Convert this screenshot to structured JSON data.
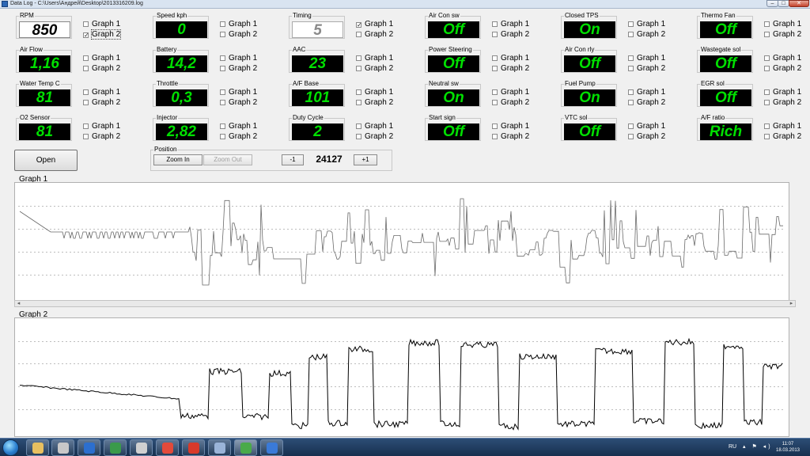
{
  "window": {
    "title": "Data Log - C:\\Users\\Андрей\\Desktop\\2013316209.log",
    "minimize_glyph": "–",
    "maximize_glyph": "□",
    "close_glyph": "✕"
  },
  "checkbox_labels": {
    "graph1": "Graph 1",
    "graph2": "Graph 2"
  },
  "sensors": [
    {
      "label": "RPM",
      "value": "850",
      "style": "white",
      "graph1": false,
      "graph2": true
    },
    {
      "label": "Speed kph",
      "value": "0",
      "style": "green",
      "graph1": false,
      "graph2": false
    },
    {
      "label": "Timing",
      "value": "5",
      "style": "dim",
      "graph1": true,
      "graph2": false
    },
    {
      "label": "Air Con sw",
      "value": "Off",
      "style": "green",
      "graph1": false,
      "graph2": false
    },
    {
      "label": "Closed TPS",
      "value": "On",
      "style": "green",
      "graph1": false,
      "graph2": false
    },
    {
      "label": "Thermo Fan",
      "value": "Off",
      "style": "green",
      "graph1": false,
      "graph2": false
    },
    {
      "label": "Air Flow",
      "value": "1,16",
      "style": "green",
      "graph1": false,
      "graph2": false
    },
    {
      "label": "Battery",
      "value": "14,2",
      "style": "green",
      "graph1": false,
      "graph2": false
    },
    {
      "label": "AAC",
      "value": "23",
      "style": "green",
      "graph1": false,
      "graph2": false
    },
    {
      "label": "Power Steering",
      "value": "Off",
      "style": "green",
      "graph1": false,
      "graph2": false
    },
    {
      "label": "Air Con rly",
      "value": "Off",
      "style": "green",
      "graph1": false,
      "graph2": false
    },
    {
      "label": "Wastegate sol",
      "value": "Off",
      "style": "green",
      "graph1": false,
      "graph2": false
    },
    {
      "label": "Water Temp C",
      "value": "81",
      "style": "green",
      "graph1": false,
      "graph2": false
    },
    {
      "label": "Throttle",
      "value": "0,3",
      "style": "green",
      "graph1": false,
      "graph2": false
    },
    {
      "label": "A/F Base",
      "value": "101",
      "style": "green",
      "graph1": false,
      "graph2": false
    },
    {
      "label": "Neutral sw",
      "value": "On",
      "style": "green",
      "graph1": false,
      "graph2": false
    },
    {
      "label": "Fuel Pump",
      "value": "On",
      "style": "green",
      "graph1": false,
      "graph2": false
    },
    {
      "label": "EGR sol",
      "value": "Off",
      "style": "green",
      "graph1": false,
      "graph2": false
    },
    {
      "label": "O2 Sensor",
      "value": "81",
      "style": "green",
      "graph1": false,
      "graph2": false
    },
    {
      "label": "Injector",
      "value": "2,82",
      "style": "green",
      "graph1": false,
      "graph2": false
    },
    {
      "label": "Duty Cycle",
      "value": "2",
      "style": "green",
      "graph1": false,
      "graph2": false
    },
    {
      "label": "Start sign",
      "value": "Off",
      "style": "green",
      "graph1": false,
      "graph2": false
    },
    {
      "label": "VTC sol",
      "value": "Off",
      "style": "green",
      "graph1": false,
      "graph2": false
    },
    {
      "label": "A/F ratio",
      "value": "Rich",
      "style": "green",
      "graph1": false,
      "graph2": false
    }
  ],
  "controls": {
    "open_label": "Open",
    "position_label": "Position",
    "zoom_in_label": "Zoom In",
    "zoom_out_label": "Zoom Out",
    "minus_label": "-1",
    "position_value": "24127",
    "plus_label": "+1"
  },
  "graphs": {
    "graph1_title": "Graph 1",
    "graph2_title": "Graph 2",
    "scroll_left": "◂",
    "scroll_right": "▸"
  },
  "taskbar": {
    "apps": [
      "folder-icon",
      "disk-manager-icon",
      "powershell-icon",
      "globe-icon",
      "inkscape-icon",
      "chrome-icon",
      "app-icon",
      "tools-icon",
      "datalog-icon",
      "ie-icon"
    ],
    "app_colors": [
      "#e8c060",
      "#c8c8c8",
      "#2c6fcf",
      "#3a9a4a",
      "#d0d0d0",
      "#e24a3a",
      "#d83a2a",
      "#9ab4d8",
      "#4aaa4a",
      "#3a7ad8"
    ],
    "language": "RU",
    "tray": "▴ ⚑ ◂)",
    "time": "11:07",
    "date": "18.03.2013"
  }
}
